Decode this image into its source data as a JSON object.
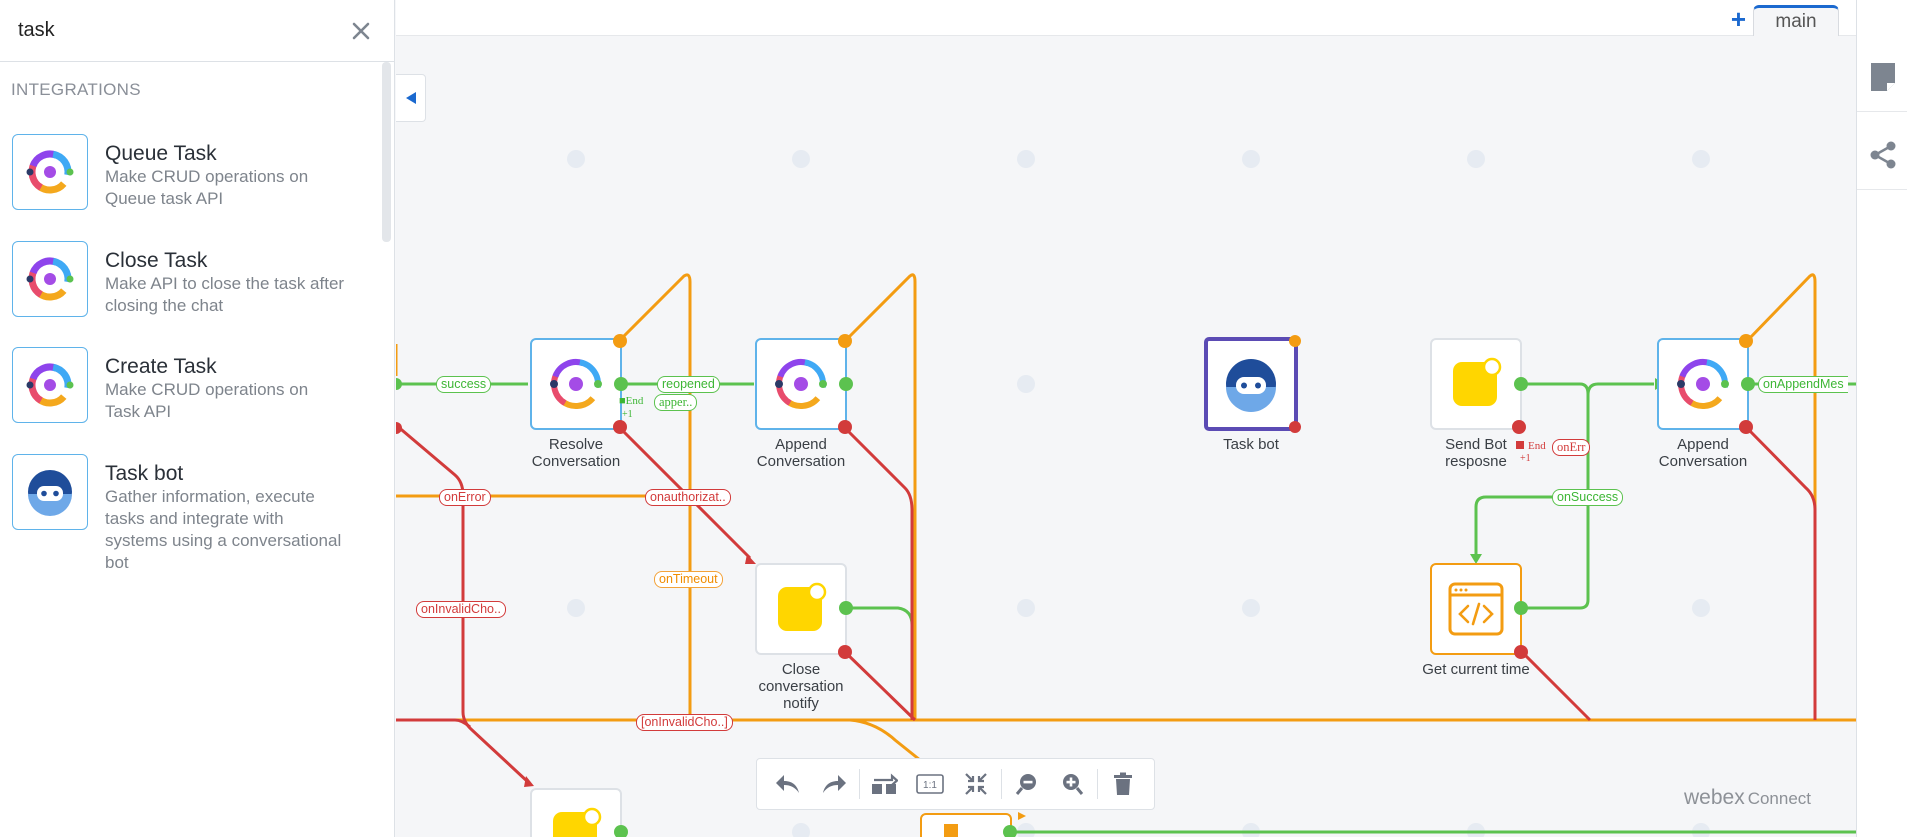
{
  "search": {
    "value": "task"
  },
  "sidebar": {
    "section_title": "INTEGRATIONS",
    "items": [
      {
        "name": "Queue Task",
        "desc": "Make CRUD operations on Queue task API"
      },
      {
        "name": "Close Task",
        "desc": "Make API to close the task after closing the chat"
      },
      {
        "name": "Create Task",
        "desc": "Make CRUD operations on Task API"
      },
      {
        "name": "Task bot",
        "desc": "Gather information, execute tasks and integrate with systems using a conversational bot"
      }
    ]
  },
  "tabs": {
    "add_icon": "plus-icon",
    "main_label": "main"
  },
  "nodes": {
    "resolve": "Resolve\nConversation",
    "append1": "Append\nConversation",
    "task_bot": "Task bot",
    "send_bot": "Send Bot\nresposne",
    "append2": "Append\nConversation",
    "close_notify": "Close\nconversation\nnotify",
    "get_time": "Get current time"
  },
  "edge_labels": {
    "success": "success",
    "reopened": "reopened",
    "on_error": "onError",
    "on_authorization": "onauthorizat..",
    "on_timeout": "onTimeout",
    "on_invalid_choice_1": "onInvalidCho..",
    "on_invalid_choice_2": "[onInvalidCho..]",
    "on_success": "onSuccess",
    "on_append_message": "onAppendMes",
    "on_error_short": "onErr",
    "append_short": "apper..",
    "end_1": "End",
    "end_2": "End",
    "plus_one_1": "+1",
    "plus_one_2": "+1"
  },
  "toolbar": {
    "buttons": [
      "undo-icon",
      "redo-icon",
      "swap-icon",
      "actual-size-icon",
      "fit-icon",
      "zoom-out-icon",
      "zoom-in-icon",
      "trash-icon"
    ],
    "actual_size_label": "1:1"
  },
  "brand": {
    "name": "webex",
    "sub": "Connect"
  },
  "colors": {
    "accent": "#1b69cf",
    "green": "#5cc24f",
    "red": "#d23b3b",
    "orange": "#f39c12",
    "bot_purple": "#5b4bb4"
  }
}
